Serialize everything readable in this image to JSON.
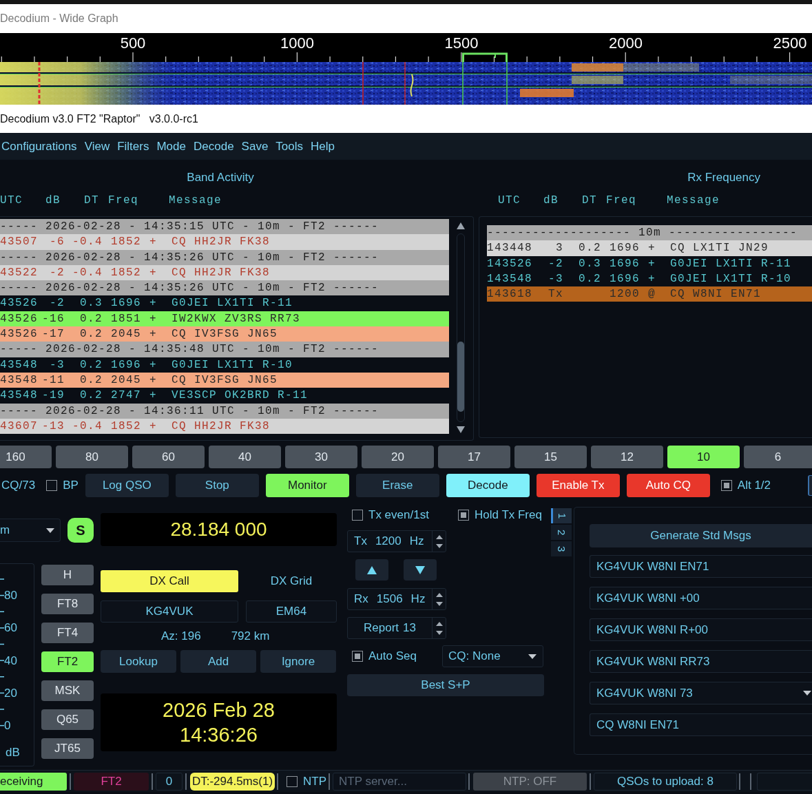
{
  "wide_graph": {
    "title": "Decodium - Wide Graph",
    "scale_labels": [
      "500",
      "1000",
      "1500",
      "2000",
      "2500"
    ]
  },
  "app": {
    "title": "Decodium v3.0 FT2 \"Raptor\"   v3.0.0-rc1"
  },
  "menu": [
    "Configurations",
    "View",
    "Filters",
    "Mode",
    "Decode",
    "Save",
    "Tools",
    "Help"
  ],
  "band_activity": {
    "title": "Band Activity",
    "columns": [
      "UTC",
      "dB",
      "DT",
      "Freq",
      "Message"
    ],
    "rows": [
      {
        "kind": "separator",
        "text": "----- 2026-02-28 - 14:35:15 UTC - 10m - FT2 ------"
      },
      {
        "kind": "flagged",
        "utc": "43507",
        "db": "-6",
        "dt": "-0.4",
        "freq": "1852",
        "mark": "+",
        "message": "CQ HH2JR FK38",
        "color": "#d4d4d4"
      },
      {
        "kind": "separator",
        "text": "----- 2026-02-28 - 14:35:26 UTC - 10m - FT2 ------"
      },
      {
        "kind": "flagged",
        "utc": "43522",
        "db": "-2",
        "dt": "-0.4",
        "freq": "1852",
        "mark": "+",
        "message": "CQ HH2JR FK38",
        "color": "#d4d4d4"
      },
      {
        "kind": "separator",
        "text": "----- 2026-02-28 - 14:35:26 UTC - 10m - FT2 ------"
      },
      {
        "kind": "decode",
        "utc": "43526",
        "db": "-2",
        "dt": "0.3",
        "freq": "1696",
        "mark": "+",
        "message": "G0JEI LX1TI R-11"
      },
      {
        "kind": "highlight",
        "utc": "43526",
        "db": "-16",
        "dt": "0.2",
        "freq": "1851",
        "mark": "+",
        "message": "IW2KWX ZV3RS RR73",
        "color": "#7ef45c"
      },
      {
        "kind": "highlight",
        "utc": "43526",
        "db": "-17",
        "dt": "0.2",
        "freq": "2045",
        "mark": "+",
        "message": "CQ IV3FSG JN65",
        "color": "#f4a882"
      },
      {
        "kind": "separator",
        "text": "----- 2026-02-28 - 14:35:48 UTC - 10m - FT2 ------"
      },
      {
        "kind": "decode",
        "utc": "43548",
        "db": "-3",
        "dt": "0.2",
        "freq": "1696",
        "mark": "+",
        "message": "G0JEI LX1TI R-10"
      },
      {
        "kind": "highlight",
        "utc": "43548",
        "db": "-11",
        "dt": "0.2",
        "freq": "2045",
        "mark": "+",
        "message": "CQ IV3FSG JN65",
        "color": "#f4a882"
      },
      {
        "kind": "decode",
        "utc": "43548",
        "db": "-19",
        "dt": "0.2",
        "freq": "2747",
        "mark": "+",
        "message": "VE3SCP OK2BRD R-11"
      },
      {
        "kind": "separator",
        "text": "----- 2026-02-28 - 14:36:11 UTC - 10m - FT2 ------"
      },
      {
        "kind": "flagged",
        "utc": "43607",
        "db": "-13",
        "dt": "-0.4",
        "freq": "1852",
        "mark": "+",
        "message": "CQ HH2JR FK38",
        "color": "#d4d4d4"
      }
    ]
  },
  "rx_frequency": {
    "title": "Rx Frequency",
    "columns": [
      "UTC",
      "dB",
      "DT",
      "Freq",
      "Message"
    ],
    "rows": [
      {
        "kind": "separator",
        "text": "------------------- 10m -----------------"
      },
      {
        "kind": "highlight",
        "utc": "143448",
        "db": "3",
        "dt": "0.2",
        "freq": "1696",
        "mark": "+",
        "message": "CQ LX1TI JN29",
        "color": "#d6d6d6"
      },
      {
        "kind": "decode",
        "utc": "143526",
        "db": "-2",
        "dt": "0.3",
        "freq": "1696",
        "mark": "+",
        "message": "G0JEI LX1TI R-11"
      },
      {
        "kind": "decode",
        "utc": "143548",
        "db": "-3",
        "dt": "0.2",
        "freq": "1696",
        "mark": "+",
        "message": "G0JEI LX1TI R-10"
      },
      {
        "kind": "highlight",
        "utc": "143618",
        "db": "Tx",
        "freq": "1200",
        "mark": "@",
        "message": "CQ W8NI EN71",
        "color": "#b5631c"
      }
    ]
  },
  "bands": [
    {
      "label": "160",
      "selected": false
    },
    {
      "label": "80",
      "selected": false
    },
    {
      "label": "60",
      "selected": false
    },
    {
      "label": "40",
      "selected": false
    },
    {
      "label": "30",
      "selected": false
    },
    {
      "label": "20",
      "selected": false
    },
    {
      "label": "17",
      "selected": false
    },
    {
      "label": "15",
      "selected": false
    },
    {
      "label": "12",
      "selected": false
    },
    {
      "label": "10",
      "selected": true
    },
    {
      "label": "6",
      "selected": false
    }
  ],
  "control_row": [
    {
      "kind": "label",
      "label": "CQ/73"
    },
    {
      "kind": "checkbox",
      "label": "BP",
      "checked": false
    },
    {
      "kind": "button",
      "label": "Log QSO",
      "on": false
    },
    {
      "kind": "button",
      "label": "Stop",
      "on": false
    },
    {
      "kind": "button",
      "label": "Monitor",
      "on": true,
      "color": "#7ef45c"
    },
    {
      "kind": "button",
      "label": "Erase",
      "on": false
    },
    {
      "kind": "button",
      "label": "Decode",
      "on": true,
      "color": "#80f0fa"
    },
    {
      "kind": "button",
      "label": "Enable Tx",
      "on": true,
      "color": "#e8372b"
    },
    {
      "kind": "button",
      "label": "Auto CQ",
      "on": true,
      "color": "#e8372b"
    },
    {
      "kind": "checkbox",
      "label": "Alt 1/2",
      "checked": true
    }
  ],
  "band_select": {
    "value": "m"
  },
  "rig_button": {
    "label": "S",
    "ok": true
  },
  "frequency_display": "28.184 000",
  "meter": {
    "labels": [
      "80",
      "60",
      "40",
      "20",
      "0"
    ],
    "reading": "dB"
  },
  "modes": [
    {
      "label": "H",
      "selected": false
    },
    {
      "label": "FT8",
      "selected": false
    },
    {
      "label": "FT4",
      "selected": false
    },
    {
      "label": "FT2",
      "selected": true
    },
    {
      "label": "MSK",
      "selected": false
    },
    {
      "label": "Q65",
      "selected": false
    },
    {
      "label": "JT65",
      "selected": false
    }
  ],
  "dx": {
    "call_label": "DX Call",
    "grid_label": "DX Grid",
    "call": "KG4VUK",
    "grid": "EM64",
    "azimuth": "Az: 196",
    "distance": "792 km",
    "buttons": [
      "Lookup",
      "Add",
      "Ignore"
    ]
  },
  "datetime": {
    "date": "2026 Feb 28",
    "time": "14:36:26"
  },
  "tx_options": [
    {
      "label": "Tx even/1st",
      "checked": false
    },
    {
      "label": "Hold Tx Freq",
      "checked": true
    }
  ],
  "tx_freq": {
    "prefix": "Tx",
    "value": "1200",
    "suffix": "Hz"
  },
  "rx_freq": {
    "prefix": "Rx",
    "value": "1506",
    "suffix": "Hz"
  },
  "report": {
    "prefix": "Report",
    "value": "13"
  },
  "auto_seq": {
    "label": "Auto Seq",
    "checked": true
  },
  "cq_select": {
    "value": "CQ: None"
  },
  "best_sp": "Best S+P",
  "message_tabs": [
    {
      "label": "1",
      "selected": true
    },
    {
      "label": "2",
      "selected": false
    },
    {
      "label": "3",
      "selected": false
    }
  ],
  "messages": {
    "generate": "Generate Std Msgs",
    "items": [
      {
        "kind": "field",
        "value": "KG4VUK W8NI EN71"
      },
      {
        "kind": "field",
        "value": "KG4VUK W8NI +00"
      },
      {
        "kind": "field",
        "value": "KG4VUK W8NI R+00"
      },
      {
        "kind": "field",
        "value": "KG4VUK W8NI RR73"
      },
      {
        "kind": "combo",
        "value": "KG4VUK W8NI 73"
      },
      {
        "kind": "field",
        "value": "CQ W8NI EN71"
      }
    ]
  },
  "status_bar": {
    "state": "eceiving",
    "mode": "FT2",
    "count": "0",
    "dt": "DT:-294.5ms(1)",
    "ntp": {
      "label": "NTP",
      "checked": false
    },
    "ntp_server": {
      "placeholder": "NTP server..."
    },
    "ntp_status": "NTP: OFF",
    "upload": "QSOs to upload: 8"
  }
}
